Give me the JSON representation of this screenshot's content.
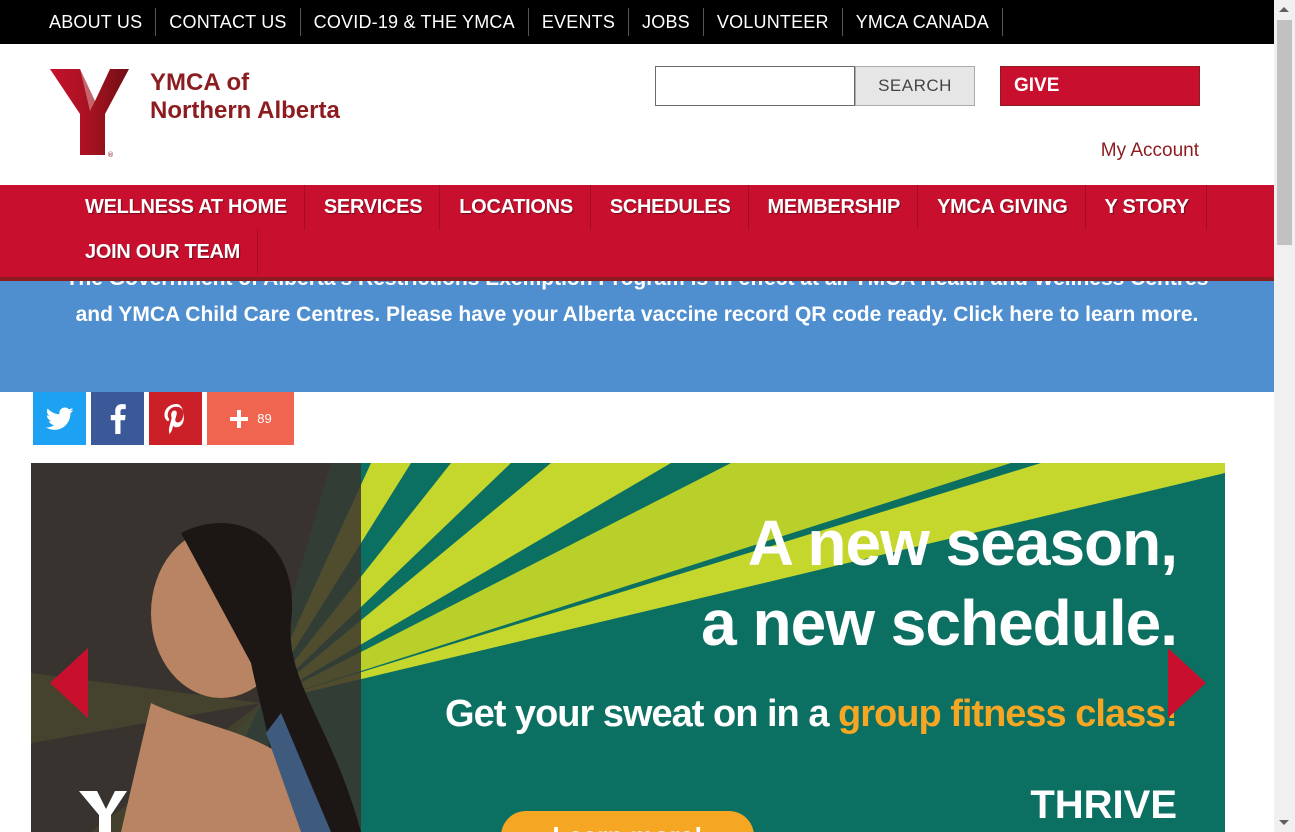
{
  "utility_nav": [
    "ABOUT US",
    "CONTACT US",
    "COVID-19 & THE YMCA",
    "EVENTS",
    "JOBS",
    "VOLUNTEER",
    "YMCA CANADA"
  ],
  "header": {
    "logo_line1": "YMCA of",
    "logo_line2": "Northern Alberta",
    "search_button": "SEARCH",
    "search_value": "",
    "give_button": "GIVE",
    "account_link": "My Account"
  },
  "main_nav": [
    "WELLNESS AT HOME",
    "SERVICES",
    "LOCATIONS",
    "SCHEDULES",
    "MEMBERSHIP",
    "YMCA GIVING",
    "Y STORY",
    "JOIN OUR TEAM"
  ],
  "alert": {
    "text": "The Government of Alberta's Restrictions Exemption Program is in effect at all YMCA Health and Wellness Centres and YMCA Child Care Centres. Please have your Alberta vaccine record QR code ready. Click here to learn more."
  },
  "share": {
    "count": "89"
  },
  "hero": {
    "headline_line1": "A new season,",
    "headline_line2": "a new schedule.",
    "sub_prefix": "Get your sweat on in a ",
    "sub_highlight": "group fitness class!",
    "brand_word": "THRIVE",
    "cta": "Learn more!"
  },
  "colors": {
    "brand_red": "#c8102e",
    "brand_dark_red": "#8c1c1f",
    "alert_blue": "#4f8fd0",
    "hero_teal": "#0b6f62",
    "hero_lime": "#c5d72d",
    "hero_orange": "#f5a623"
  },
  "icons": [
    "twitter-icon",
    "facebook-icon",
    "pinterest-icon",
    "plus-icon",
    "chevron-left-icon",
    "chevron-right-icon",
    "ymca-logo-icon"
  ]
}
